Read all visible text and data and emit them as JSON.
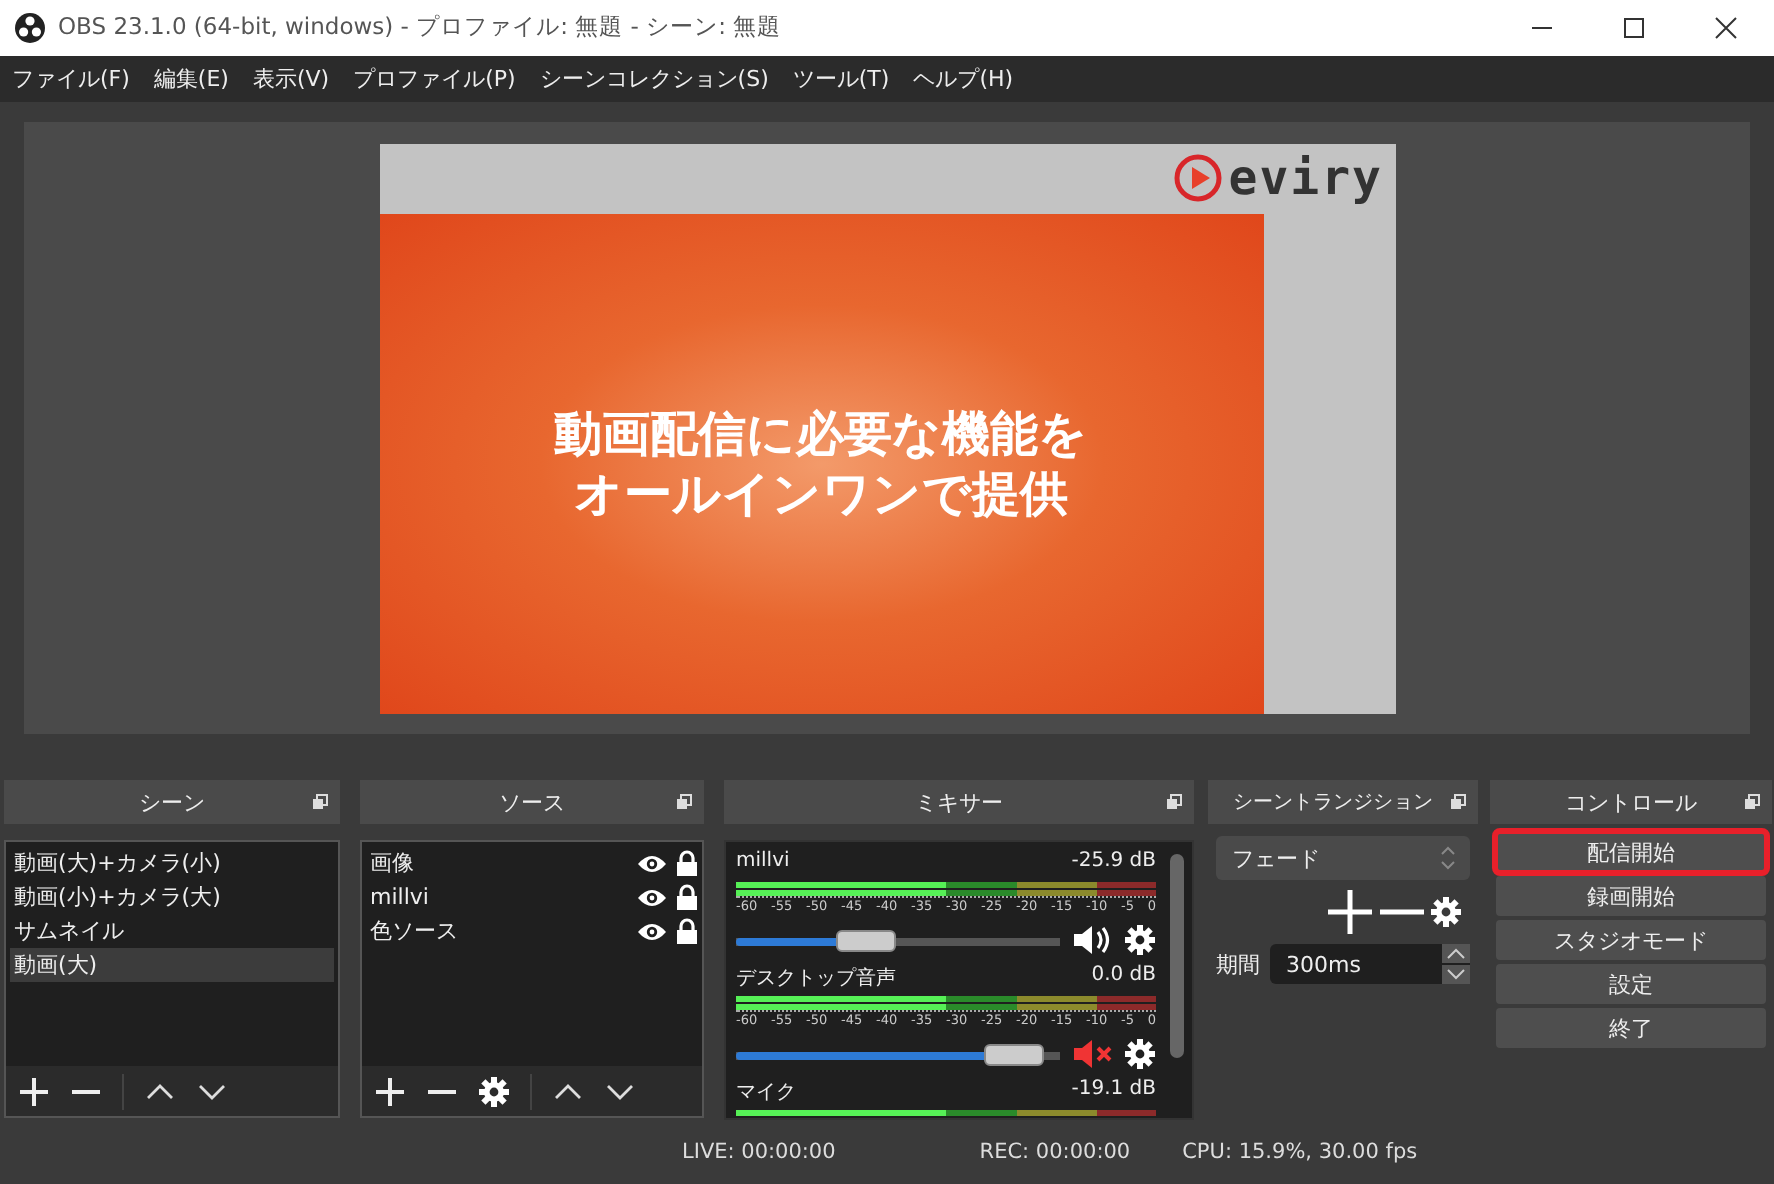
{
  "window": {
    "title": "OBS 23.1.0 (64-bit, windows) - プロファイル: 無題 - シーン: 無題"
  },
  "menu": [
    "ファイル(F)",
    "編集(E)",
    "表示(V)",
    "プロファイル(P)",
    "シーンコレクション(S)",
    "ツール(T)",
    "ヘルプ(H)"
  ],
  "preview": {
    "logo": "eviry",
    "headline": [
      "動画配信に必要な機能を",
      "オールインワンで提供"
    ]
  },
  "scenes": {
    "title": "シーン",
    "items": [
      {
        "label": "動画(大)+カメラ(小)",
        "selected": false
      },
      {
        "label": "動画(小)+カメラ(大)",
        "selected": false
      },
      {
        "label": "サムネイル",
        "selected": false
      },
      {
        "label": "動画(大)",
        "selected": true
      }
    ]
  },
  "sources": {
    "title": "ソース",
    "items": [
      {
        "label": "画像"
      },
      {
        "label": "millvi"
      },
      {
        "label": "色ソース"
      }
    ]
  },
  "mixer": {
    "title": "ミキサー",
    "channels": [
      {
        "name": "millvi",
        "reading": "-25.9 dB",
        "ticks": [
          "-60",
          "-55",
          "-50",
          "-45",
          "-40",
          "-35",
          "-30",
          "-25",
          "-20",
          "-15",
          "-10",
          "-5",
          "0"
        ],
        "level": 0.38,
        "muted": false
      },
      {
        "name": "デスクトップ音声",
        "reading": "0.0 dB",
        "ticks": [
          "-60",
          "-55",
          "-50",
          "-45",
          "-40",
          "-35",
          "-30",
          "-25",
          "-20",
          "-15",
          "-10",
          "-5",
          "0"
        ],
        "level": 0.94,
        "muted": true
      },
      {
        "name": "マイク",
        "reading": "-19.1 dB"
      }
    ]
  },
  "transitions": {
    "title": "シーントランジション",
    "transition": "フェード",
    "duration_label": "期間",
    "duration": "300ms"
  },
  "controls": {
    "title": "コントロール",
    "buttons": [
      {
        "label": "配信開始",
        "highlighted": true
      },
      {
        "label": "録画開始",
        "highlighted": false
      },
      {
        "label": "スタジオモード",
        "highlighted": false
      },
      {
        "label": "設定",
        "highlighted": false
      },
      {
        "label": "終了",
        "highlighted": false
      }
    ]
  },
  "status_bar": {
    "live": "LIVE: 00:00:00",
    "rec": "REC: 00:00:00",
    "cpu": "CPU: 15.9%, 30.00 fps"
  }
}
